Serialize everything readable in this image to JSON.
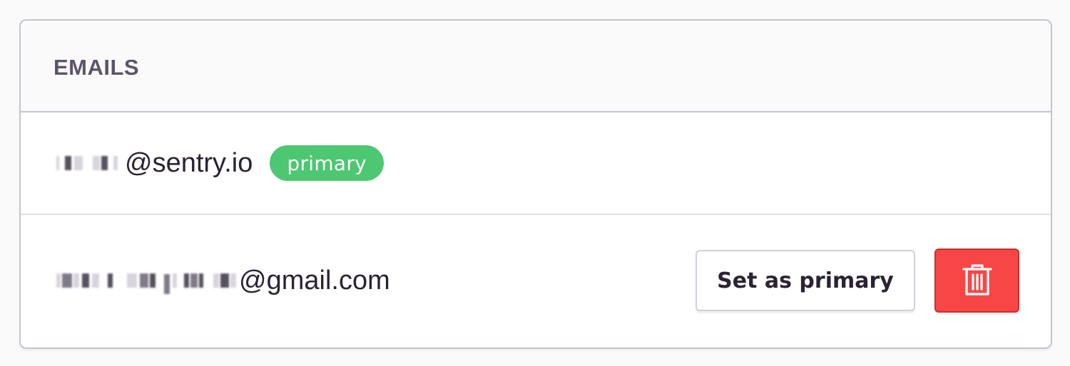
{
  "panel": {
    "title": "Emails"
  },
  "emails": [
    {
      "local_part_redacted": true,
      "domain": "@sentry.io",
      "is_primary": true,
      "badge_label": "primary"
    },
    {
      "local_part_redacted": true,
      "domain": "@gmail.com",
      "is_primary": false,
      "set_primary_label": "Set as primary",
      "delete_icon": "trash-icon"
    }
  ],
  "colors": {
    "primary_badge": "#4dc771",
    "danger": "#f84646",
    "border": "#c9c0d1",
    "heading_text": "#5d5469",
    "body_text": "#2b2233"
  }
}
